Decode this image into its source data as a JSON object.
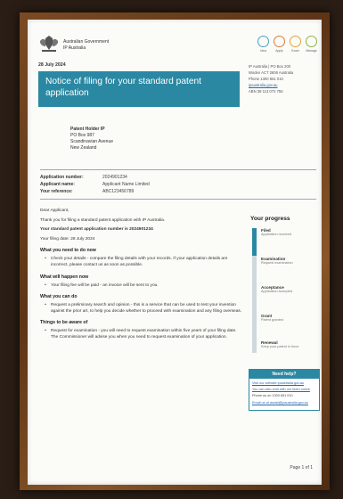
{
  "header": {
    "gov_line1": "Australian Government",
    "gov_line2": "IP Australia",
    "date": "28 July 2024"
  },
  "circles": [
    {
      "label": "Idea",
      "color": "#4aa3c4"
    },
    {
      "label": "Apply",
      "color": "#e07a3a"
    },
    {
      "label": "Exam",
      "color": "#e0a33a"
    },
    {
      "label": "Manage",
      "color": "#8ab843"
    }
  ],
  "title": "Notice of filing for your standard patent application",
  "contact": [
    "IP Australia | PO Box 200",
    "Woden ACT 2606 Australia",
    "Phone 1300 651 010",
    "ipaustralia.gov.au",
    "ABN 38 113 072 755"
  ],
  "address": {
    "name": "Patent Holder IP",
    "line1": "PO Box 987",
    "line2": "Scandinavian Avenue",
    "line3": "New Zealand"
  },
  "refs": [
    {
      "k": "Application number:",
      "v": "2024901234"
    },
    {
      "k": "Applicant name:",
      "v": "Applicant Name Limited"
    },
    {
      "k": "Your reference:",
      "v": "ABC123456789"
    }
  ],
  "body": {
    "greeting": "Dear Applicant,",
    "intro": "Thank you for filing a standard patent application with IP Australia.",
    "app_number_line": "Your standard patent application number is 2024901234",
    "filing_date_line": "Your filing date: 28 July 2024",
    "h_need": "What you need to do now",
    "need_bullet": "Check your details - compare the filing details with your records. If your application details are incorrect, please contact us as soon as possible.",
    "h_happen": "What will happen now",
    "happen_bullet": "Your filing fee will be paid - an invoice will be sent to you.",
    "h_can": "What you can do",
    "can_bullet": "Request a preliminary search and opinion - this is a service that can be used to test your invention against the prior art, to help you decide whether to proceed with examination and any filing overseas.",
    "h_consider": "Things to be aware of",
    "consider_bullet": "Request for examination - you will need to request examination within five years of your filing date. The Commissioner will advise you when you need to request examination of your application."
  },
  "progress": {
    "title": "Your progress",
    "fill_fraction": 0.22,
    "steps": [
      {
        "title": "Filed",
        "desc": "Application received"
      },
      {
        "title": "Examination",
        "desc": "Request examination"
      },
      {
        "title": "Acceptance",
        "desc": "Application accepted"
      },
      {
        "title": "Grant",
        "desc": "Patent granted"
      },
      {
        "title": "Renewal",
        "desc": "Keep your patent in force"
      }
    ]
  },
  "help": {
    "title": "Need help?",
    "lines": [
      "Visit our website ipaustralia.gov.au",
      "You can also chat with our team online",
      "Phone us on 1300 651 010",
      "Email us at assist@ipaustralia.gov.au"
    ]
  },
  "page": "Page 1 of 1"
}
